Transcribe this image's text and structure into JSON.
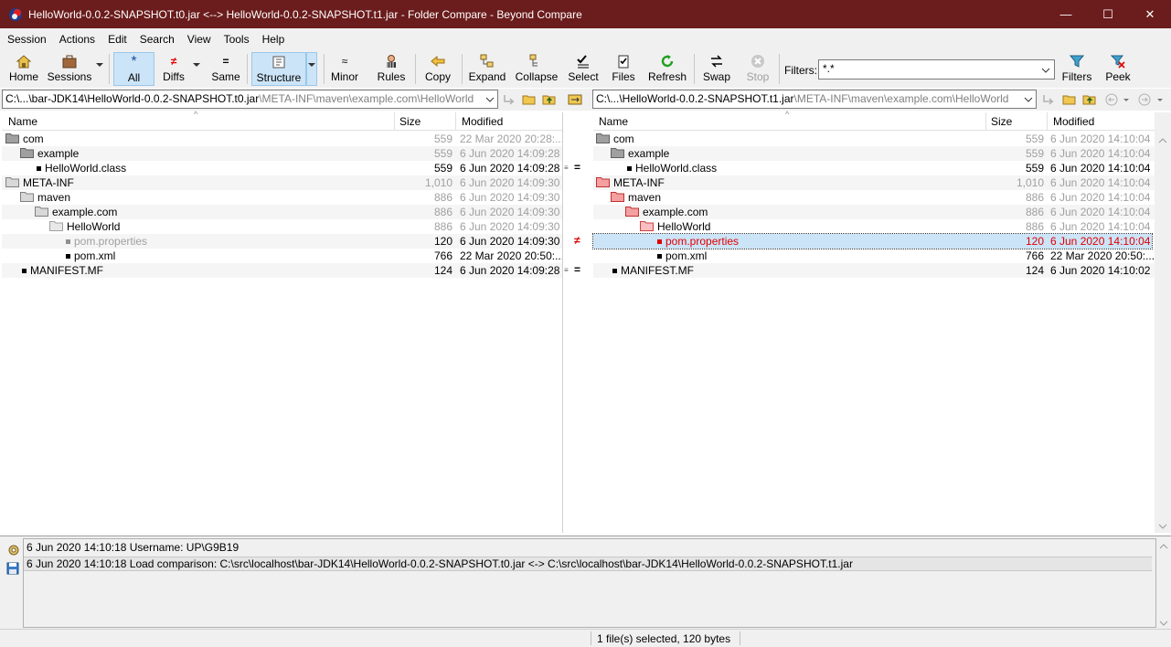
{
  "window": {
    "title": "HelloWorld-0.0.2-SNAPSHOT.t0.jar <--> HelloWorld-0.0.2-SNAPSHOT.t1.jar - Folder Compare - Beyond Compare",
    "minimize": "—",
    "maximize": "☐",
    "close": "✕"
  },
  "menu": [
    "Session",
    "Actions",
    "Edit",
    "Search",
    "View",
    "Tools",
    "Help"
  ],
  "toolbar": {
    "home": "Home",
    "sessions": "Sessions",
    "all": "All",
    "diffs": "Diffs",
    "same": "Same",
    "structure": "Structure",
    "minor": "Minor",
    "rules": "Rules",
    "copy": "Copy",
    "expand": "Expand",
    "collapse": "Collapse",
    "select": "Select",
    "files": "Files",
    "refresh": "Refresh",
    "swap": "Swap",
    "stop": "Stop",
    "filters_label": "Filters:",
    "filters_value": "*.*",
    "filters_button": "Filters",
    "peek": "Peek"
  },
  "paths": {
    "left_main": "C:\\...\\bar-JDK14\\HelloWorld-0.0.2-SNAPSHOT.t0.jar",
    "left_dim": "\\META-INF\\maven\\example.com\\HelloWorld",
    "right_main": "C:\\...\\HelloWorld-0.0.2-SNAPSHOT.t1.jar",
    "right_dim": "\\META-INF\\maven\\example.com\\HelloWorld"
  },
  "columns": {
    "name": "Name",
    "size": "Size",
    "modified": "Modified"
  },
  "left_rows": [
    {
      "name": "com",
      "size": "559",
      "modified": "22 Mar 2020 20:28:..."
    },
    {
      "name": "example",
      "size": "559",
      "modified": "6 Jun 2020 14:09:28"
    },
    {
      "name": "HelloWorld.class",
      "size": "559",
      "modified": "6 Jun 2020 14:09:28"
    },
    {
      "name": "META-INF",
      "size": "1,010",
      "modified": "6 Jun 2020 14:09:30"
    },
    {
      "name": "maven",
      "size": "886",
      "modified": "6 Jun 2020 14:09:30"
    },
    {
      "name": "example.com",
      "size": "886",
      "modified": "6 Jun 2020 14:09:30"
    },
    {
      "name": "HelloWorld",
      "size": "886",
      "modified": "6 Jun 2020 14:09:30"
    },
    {
      "name": "pom.properties",
      "size": "120",
      "modified": "6 Jun 2020 14:09:30"
    },
    {
      "name": "pom.xml",
      "size": "766",
      "modified": "22 Mar 2020 20:50:..."
    },
    {
      "name": "MANIFEST.MF",
      "size": "124",
      "modified": "6 Jun 2020 14:09:28"
    }
  ],
  "right_rows": [
    {
      "name": "com",
      "size": "559",
      "modified": "6 Jun 2020 14:10:04"
    },
    {
      "name": "example",
      "size": "559",
      "modified": "6 Jun 2020 14:10:04"
    },
    {
      "name": "HelloWorld.class",
      "size": "559",
      "modified": "6 Jun 2020 14:10:04"
    },
    {
      "name": "META-INF",
      "size": "1,010",
      "modified": "6 Jun 2020 14:10:04"
    },
    {
      "name": "maven",
      "size": "886",
      "modified": "6 Jun 2020 14:10:04"
    },
    {
      "name": "example.com",
      "size": "886",
      "modified": "6 Jun 2020 14:10:04"
    },
    {
      "name": "HelloWorld",
      "size": "886",
      "modified": "6 Jun 2020 14:10:04"
    },
    {
      "name": "pom.properties",
      "size": "120",
      "modified": "6 Jun 2020 14:10:04"
    },
    {
      "name": "pom.xml",
      "size": "766",
      "modified": "22 Mar 2020 20:50:..."
    },
    {
      "name": "MANIFEST.MF",
      "size": "124",
      "modified": "6 Jun 2020 14:10:02"
    }
  ],
  "middle": {
    "eq": "=",
    "neq": "≠"
  },
  "log": [
    "6 Jun 2020 14:10:18   Username: UP\\G9B19",
    "6 Jun 2020 14:10:18   Load comparison: C:\\src\\localhost\\bar-JDK14\\HelloWorld-0.0.2-SNAPSHOT.t0.jar <-> C:\\src\\localhost\\bar-JDK14\\HelloWorld-0.0.2-SNAPSHOT.t1.jar"
  ],
  "status": "1 file(s) selected, 120 bytes"
}
